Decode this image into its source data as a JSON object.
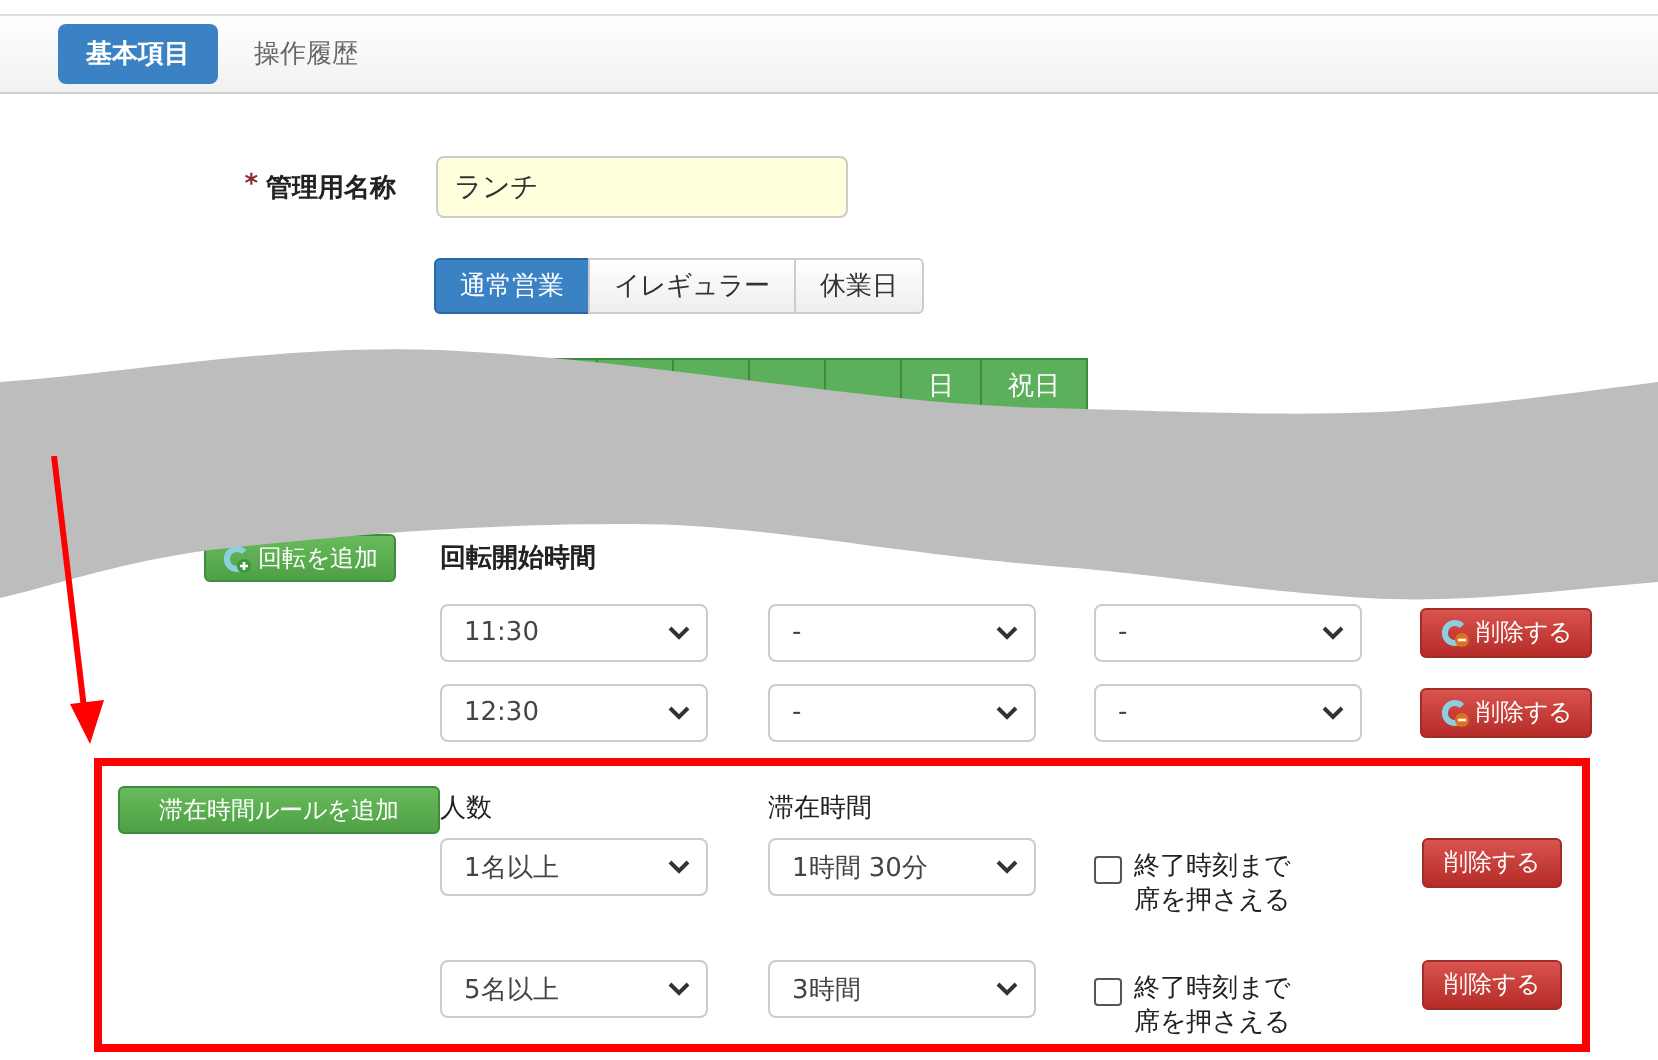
{
  "tabs": [
    {
      "label": "基本項目",
      "selected": true
    },
    {
      "label": "操作履歴",
      "selected": false
    }
  ],
  "name_field": {
    "label": "管理用名称",
    "required_mark": "*",
    "value": "ランチ"
  },
  "business_types": [
    {
      "label": "通常営業",
      "selected": true
    },
    {
      "label": "イレギュラー",
      "selected": false
    },
    {
      "label": "休業日",
      "selected": false
    }
  ],
  "days": [
    {
      "label": "日"
    },
    {
      "label": "祝日"
    }
  ],
  "rotation": {
    "add_button": "回転を追加",
    "column_header": "回転開始時間",
    "rows": [
      {
        "values": [
          "11:30",
          "-",
          "-"
        ],
        "delete_button": "削除する"
      },
      {
        "values": [
          "12:30",
          "-",
          "-"
        ],
        "delete_button": "削除する"
      }
    ]
  },
  "stay_rules": {
    "add_button": "滞在時間ルールを追加",
    "headers": [
      "人数",
      "滞在時間"
    ],
    "rows": [
      {
        "people": "1名以上",
        "duration": "1時間 30分",
        "hold_label": "終了時刻まで席を押さえる",
        "checked": false,
        "delete_button": "削除する"
      },
      {
        "people": "5名以上",
        "duration": "3時間",
        "hold_label": "終了時刻まで席を押さえる",
        "checked": false,
        "delete_button": "削除する"
      }
    ]
  }
}
